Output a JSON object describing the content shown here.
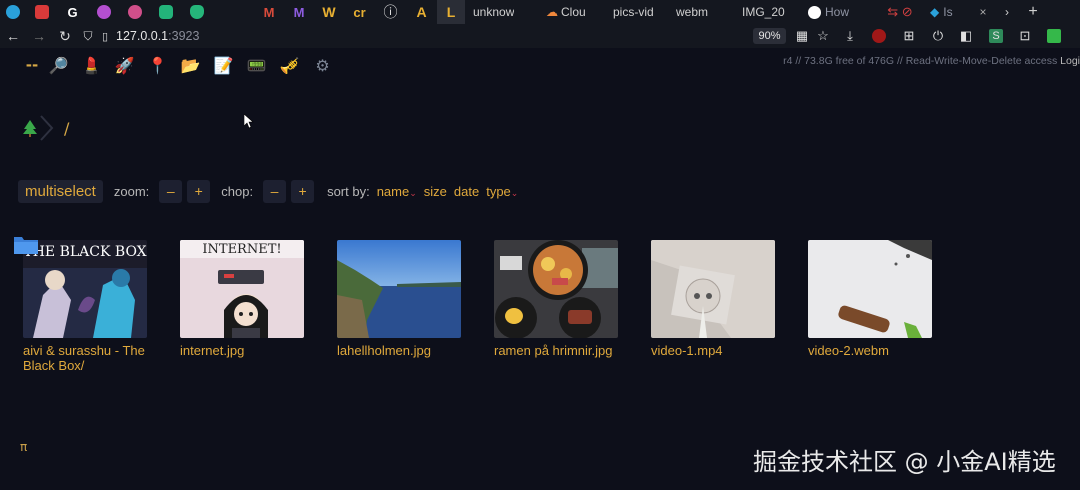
{
  "browser": {
    "tabs": [
      {
        "label": "",
        "icon": "telegram-icon",
        "color": "#2aa1da"
      },
      {
        "label": "",
        "icon": "red-badge-icon",
        "color": "#d93a3a"
      },
      {
        "label": "",
        "icon": "google-icon",
        "color": "#ffffff"
      },
      {
        "label": "",
        "icon": "circle-app-icon",
        "color": "#c44fd0"
      },
      {
        "label": "",
        "icon": "circle-app-icon",
        "color": "#d94ea0"
      },
      {
        "label": "",
        "icon": "chatgpt-icon",
        "color": "#23b37a"
      },
      {
        "label": "",
        "icon": "green-shield-icon",
        "color": "#25b67a"
      },
      {
        "label": "",
        "icon": "gmail-icon",
        "color": "#d94b3b"
      },
      {
        "label": "",
        "icon": "proton-icon",
        "color": "#8d5ce0"
      },
      {
        "label": "W",
        "icon": "w-icon",
        "color": "#e8b032"
      },
      {
        "label": "cr",
        "icon": "cr-icon",
        "color": "#e8b032"
      },
      {
        "label": "ⓘ",
        "icon": "info-icon",
        "color": "#e0e0e0"
      },
      {
        "label": "A",
        "icon": "a-icon",
        "color": "#e8b032"
      },
      {
        "label": "L",
        "icon": "l-icon",
        "color": "#e8b032"
      },
      {
        "label": "unknow",
        "icon": "",
        "color": ""
      },
      {
        "label": "Clou",
        "icon": "cloud-icon",
        "color": "#f0883c"
      },
      {
        "label": "pics-vid",
        "icon": "",
        "color": ""
      },
      {
        "label": "webm",
        "icon": "",
        "color": ""
      },
      {
        "label": "IMG_20",
        "icon": "",
        "color": ""
      },
      {
        "label": "How",
        "icon": "github-icon",
        "color": "#ffffff"
      },
      {
        "label": "",
        "icon": "arrows-icon",
        "color": "#d04040"
      },
      {
        "label": "Is",
        "icon": "twitter-icon",
        "color": "#2aa1da"
      }
    ],
    "url_host": "127.0.0.1",
    "url_port": ":3923",
    "zoom": "90%"
  },
  "app": {
    "ops": [
      "--",
      "search-icon",
      "lipstick-icon",
      "rocket-icon",
      "pin-icon",
      "folder-icon",
      "notepad-icon",
      "card-icon",
      "syringe-icon",
      "gear-icon"
    ],
    "server_info": "r4 // 73.8G free of 476G // Read-Write-Move-Delete access",
    "login": "Logi",
    "path_slash": "/",
    "toolbar": {
      "multiselect": "multiselect",
      "zoom_label": "zoom:",
      "minus": "–",
      "plus": "+",
      "chop_label": "chop:",
      "sort_label": "sort by:",
      "sort_name": "name",
      "sort_size": "size",
      "sort_date": "date",
      "sort_type": "type"
    },
    "files": [
      {
        "name": "aivi & surasshu - The Black Box/",
        "kind": "folder",
        "thumb_text": "THE BLACK BOX"
      },
      {
        "name": "internet.jpg",
        "kind": "image",
        "thumb_text": "INTERNET!"
      },
      {
        "name": "lahellholmen.jpg",
        "kind": "image",
        "thumb_text": ""
      },
      {
        "name": "ramen på hrimnir.jpg",
        "kind": "image",
        "thumb_text": ""
      },
      {
        "name": "video-1.mp4",
        "kind": "video",
        "thumb_text": ""
      },
      {
        "name": "video-2.webm",
        "kind": "video",
        "thumb_text": ""
      }
    ],
    "footer_pi": "π"
  },
  "watermark": "掘金技术社区 @ 小金AI精选",
  "colors": {
    "accent": "#e0a93c",
    "background": "#0d0f1a"
  }
}
